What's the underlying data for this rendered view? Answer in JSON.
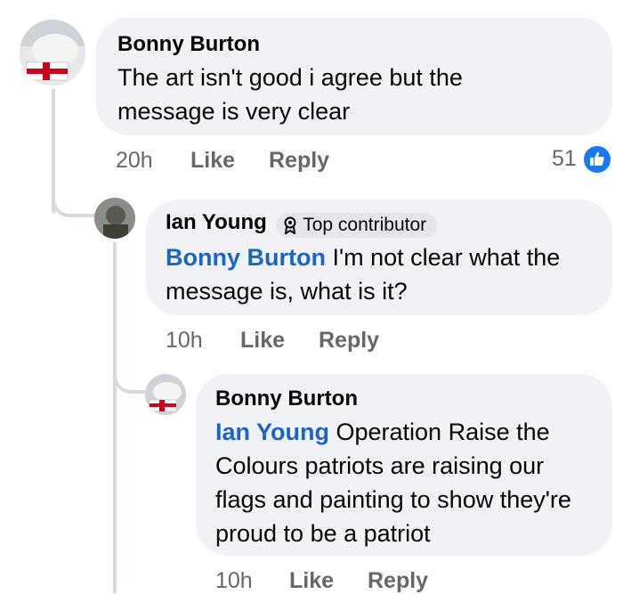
{
  "comments": [
    {
      "author": "Bonny Burton",
      "text": "The art isn't good  i agree but the message is very clear",
      "time": "20h",
      "like_label": "Like",
      "reply_label": "Reply",
      "reaction_count": "51",
      "reaction_icon": "like-reaction-icon",
      "reaction_color": "#1877f2"
    },
    {
      "author": "Ian Young",
      "badge": "Top contributor",
      "badge_icon": "medal-icon",
      "mention": "Bonny Burton",
      "text": " I'm not clear what the message is, what is it?",
      "time": "10h",
      "like_label": "Like",
      "reply_label": "Reply"
    },
    {
      "author": "Bonny Burton",
      "mention": "Ian Young",
      "text": " Operation Raise the Colours patriots are raising our flags and painting to show they're proud to be a patriot",
      "time": "10h",
      "like_label": "Like",
      "reply_label": "Reply"
    }
  ],
  "colors": {
    "bubble": "#f0f2f5",
    "mention": "#1a66c8",
    "meta": "#65676b",
    "thread_line": "#d6dade"
  }
}
